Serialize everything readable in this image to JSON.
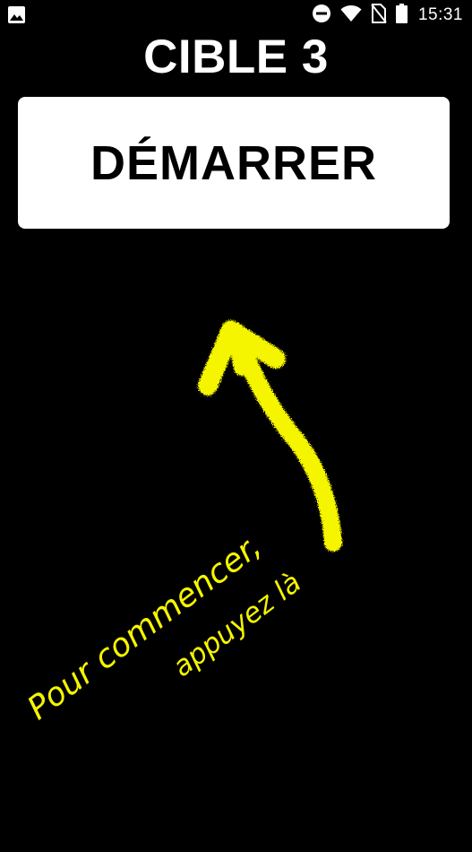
{
  "status_bar": {
    "time": "15:31",
    "icons": [
      "image-icon",
      "do-not-disturb-icon",
      "wifi-icon",
      "no-sim-icon",
      "battery-icon"
    ]
  },
  "header": {
    "title": "CIBLE 3"
  },
  "start_button": {
    "label": "DÉMARRER"
  },
  "hint": {
    "line_1": "Pour commencer,",
    "line_2": "appuyez là",
    "color": "#f5f500"
  },
  "colors": {
    "background": "#000000",
    "button_background": "#ffffff",
    "title_text": "#ffffff",
    "button_text": "#000000",
    "hint_yellow": "#f5f500"
  }
}
